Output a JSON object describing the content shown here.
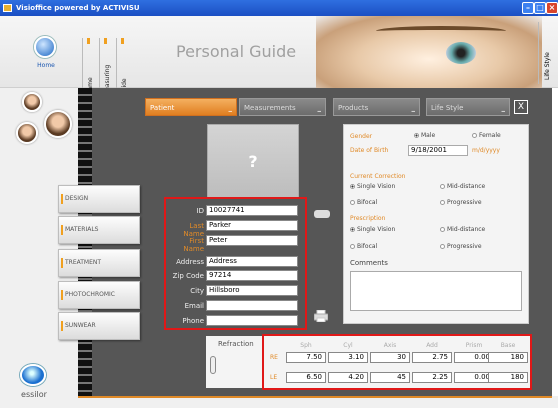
{
  "window": {
    "title": "Visioffice powered by ACTIVISU"
  },
  "header": {
    "home_label": "Home",
    "vertical_tabs": [
      "Frame",
      "Measuring",
      "Guide"
    ],
    "page_title": "Personal Guide",
    "lifestyle_tab": "Life Style"
  },
  "categories": [
    "DESIGN",
    "MATERIALS",
    "TREATMENT",
    "PHOTOCHROMIC",
    "SUNWEAR"
  ],
  "tabs": [
    {
      "label": "Patient",
      "min": "_"
    },
    {
      "label": "Measurements",
      "min": "_"
    },
    {
      "label": "Products",
      "min": "_"
    },
    {
      "label": "Life Style",
      "min": "_"
    }
  ],
  "close_label": "X",
  "patient": {
    "photo_placeholder": "?",
    "fields": [
      {
        "label": "ID",
        "value": "10027741",
        "style": "normal"
      },
      {
        "label": "Last Name",
        "value": "Parker",
        "style": "orange"
      },
      {
        "label": "First Name",
        "value": "Peter",
        "style": "orange"
      },
      {
        "label": "Address",
        "value": "Address",
        "style": "normal"
      },
      {
        "label": "Zip Code",
        "value": "97214",
        "style": "normal"
      },
      {
        "label": "City",
        "value": "Hillsboro",
        "style": "normal"
      },
      {
        "label": "Email",
        "value": "",
        "style": "normal"
      },
      {
        "label": "Phone",
        "value": "",
        "style": "normal"
      }
    ]
  },
  "details": {
    "gender_label": "Gender",
    "male": "Male",
    "female": "Female",
    "dob_label": "Date of Birth",
    "dob_value": "9/18/2001",
    "dob_format": "m/d/yyyy",
    "current_correction_label": "Current Correction",
    "cc_options": [
      "Single Vision",
      "Mid-distance",
      "Bifocal",
      "Progressive"
    ],
    "prescription_label": "Prescription",
    "rx_options": [
      "Single Vision",
      "Mid-distance",
      "Bifocal",
      "Progressive"
    ],
    "comments_label": "Comments"
  },
  "refraction": {
    "label": "Refraction",
    "headers": [
      "Sph",
      "Cyl",
      "Axis",
      "Add",
      "Prism",
      "Base"
    ],
    "rows": [
      {
        "eye": "RE",
        "values": [
          "7.50",
          "3.10",
          "30",
          "2.75",
          "0.00",
          "180"
        ]
      },
      {
        "eye": "LE",
        "values": [
          "6.50",
          "4.20",
          "45",
          "2.25",
          "0.00",
          "180"
        ]
      }
    ]
  },
  "brand": {
    "name": "essilor"
  },
  "colors": {
    "accent": "#e08a28",
    "highlight": "#e01818",
    "panel": "#565656"
  }
}
